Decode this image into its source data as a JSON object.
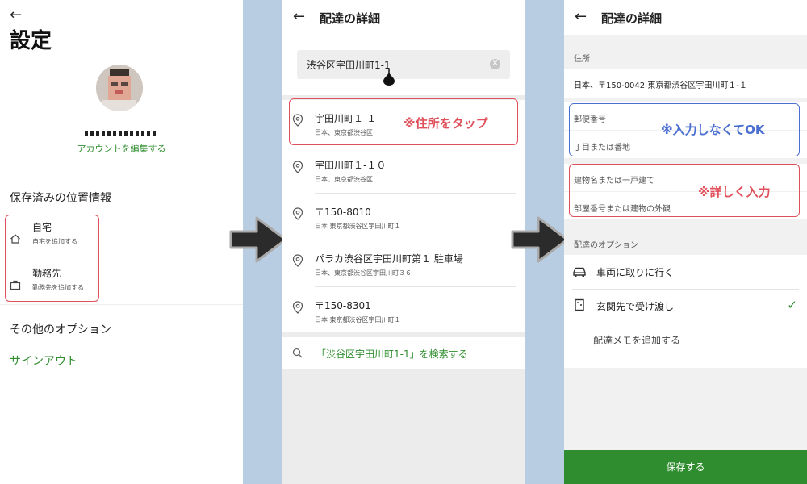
{
  "panel1": {
    "title": "設定",
    "edit_account": "アカウントを編集する",
    "saved_locations_heading": "保存済みの位置情報",
    "locations": [
      {
        "title": "自宅",
        "sub": "自宅を追加する",
        "icon": "home-icon"
      },
      {
        "title": "勤務先",
        "sub": "勤務先を追加する",
        "icon": "briefcase-icon"
      }
    ],
    "other_options_heading": "その他のオプション",
    "sign_out": "サインアウト"
  },
  "panel2": {
    "header_title": "配達の詳細",
    "search_value": "渋谷区宇田川町1-1",
    "results": [
      {
        "title": "宇田川町１-１",
        "sub": "日本、東京都渋谷区"
      },
      {
        "title": "宇田川町１-１０",
        "sub": "日本、東京都渋谷区"
      },
      {
        "title": "〒150-8010",
        "sub": "日本 東京都渋谷区宇田川町１"
      },
      {
        "title": "パラカ渋谷区宇田川町第１ 駐車場",
        "sub": "日本、東京都渋谷区宇田川町３６"
      },
      {
        "title": "〒150-8301",
        "sub": "日本 東京都渋谷区宇田川町１"
      }
    ],
    "search_link": "「渋谷区宇田川町1-1」を検索する",
    "annotation": "※住所をタップ"
  },
  "panel3": {
    "header_title": "配達の詳細",
    "address_label": "住所",
    "address_value": "日本、〒150-0042 東京都渋谷区宇田川町１-１",
    "postal_code_placeholder": "郵便番号",
    "block_placeholder": "丁目または番地",
    "building_placeholder": "建物名または一戸建て",
    "room_placeholder": "部屋番号または建物の外観",
    "annotation_blue": "※入力しなくてOK",
    "annotation_red": "※詳しく入力",
    "delivery_options_label": "配達のオプション",
    "options": [
      {
        "label": "車両に取りに行く",
        "icon": "car-icon",
        "checked": false
      },
      {
        "label": "玄関先で受け渡し",
        "icon": "door-icon",
        "checked": true
      }
    ],
    "memo": "配達メモを追加する",
    "save": "保存する"
  },
  "colors": {
    "green": "#2f8d2f",
    "annotation_red": "#e0505a",
    "annotation_blue": "#4a6fd1",
    "background": "#b9cde2"
  }
}
